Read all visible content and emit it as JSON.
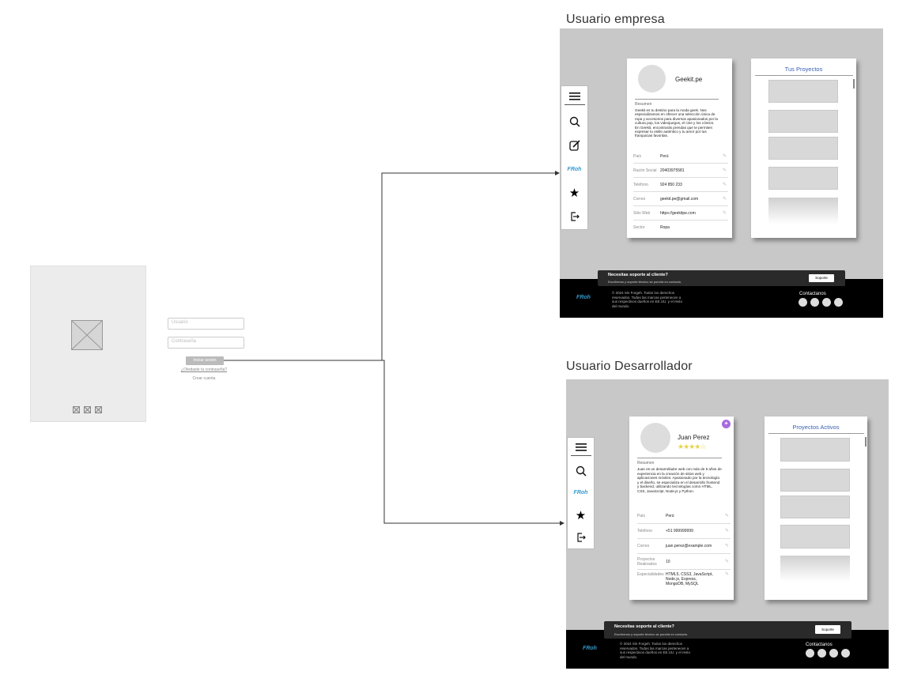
{
  "frames": {
    "empresa": {
      "title": "Usuario empresa"
    },
    "desarrollador": {
      "title": "Usuario Desarrollador"
    }
  },
  "login": {
    "user_placeholder": "Usuario",
    "password_placeholder": "Contraseña",
    "login_button": "Iniciar sesión",
    "forgot_link": "¿Olvidaste tu contraseña?",
    "register_link": "Crear cuenta"
  },
  "logo_text": "FRoh",
  "empresa": {
    "name": "Geekit.pe",
    "summary_label": "Resumen",
    "summary": "Geekit es tu destino para la moda geek. Nos especializamos en ofrecer una selección única de ropa y accesorios para diversos apasionados por la cultura pop, los videojuegos, el cine y los cómics. En Geekit, encontrarás prendas que te permiten expresar tu estilo auténtico y tu amor por tus franquicias favoritas.",
    "fields": [
      {
        "k": "País",
        "v": "Perú"
      },
      {
        "k": "Razón Social",
        "v": "20403975581"
      },
      {
        "k": "Teléfono",
        "v": "924 850 233"
      },
      {
        "k": "Correo",
        "v": "geekit.pe@gmail.com"
      },
      {
        "k": "Sitio Web",
        "v": "https://geekitpe.com"
      },
      {
        "k": "Sector",
        "v": "Ropa"
      }
    ],
    "projects_title": "Tus Proyectos"
  },
  "dev": {
    "name": "Juan Perez",
    "stars": "★★★★☆",
    "summary_label": "Resumen",
    "summary": "Juan es un desarrollador web con más de 5 años de experiencia en la creación de sitios web y aplicaciones móviles. Apasionado por la tecnología y el diseño, se especializa en el desarrollo frontend y backend, utilizando tecnologías como HTML, CSS, JavaScript, Node.js y Python.",
    "fields": [
      {
        "k": "País",
        "v": "Perú"
      },
      {
        "k": "Teléfono",
        "v": "+51 999999999"
      },
      {
        "k": "Correo",
        "v": "juan.perez@example.com"
      },
      {
        "k": "Proyectos Realizados",
        "v": "10"
      },
      {
        "k": "Especialidades",
        "v": "HTML5, CSS3, JavaScript, Node.js, Express, MongoDB, MySQL"
      }
    ],
    "projects_title": "Proyectos Activos"
  },
  "support": {
    "title": "Necesitas soporte al cliente?",
    "subtitle": "Escríbenos y soporte técnico se pondrá en contacto.",
    "button": "Soporte"
  },
  "footer": {
    "copyright": "© 2024 Sin Forgeh. Todos los derechos reservados. Todas las marcas pertenecen a sus respectivos dueños en EE.UU. y el resto del mundo.",
    "contact": "Contactanos"
  }
}
